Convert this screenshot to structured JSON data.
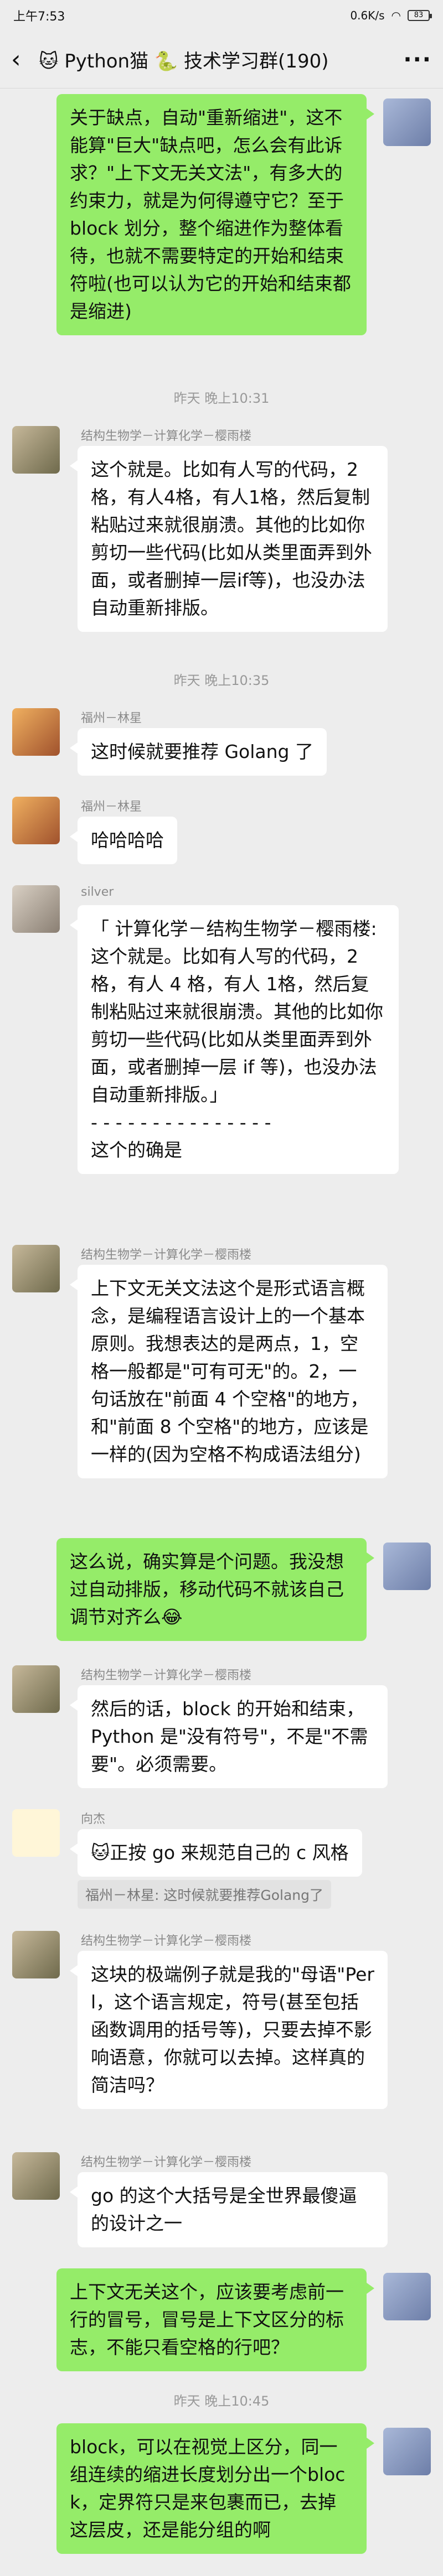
{
  "status_bar": {
    "time": "上午7:53",
    "network": "0.6K/s",
    "battery": "83"
  },
  "nav": {
    "back_icon": "‹",
    "title": "🐱 Python猫 🐍 技术学习群(190)",
    "more_icon": "···"
  },
  "messages": [
    {
      "id": "m1",
      "side": "right",
      "text": "关于缺点，自动\"重新缩进\"，这不能算\"巨大\"缺点吧，怎么会有此诉求？\"上下文无关文法\"，有多大的约束力，就是为何得遵守它？至于block 划分，整个缩进作为整体看待，也就不需要特定的开始和结束符啦(也可以认为它的开始和结束都是缩进)"
    },
    {
      "id": "t1",
      "type": "time",
      "text": "昨天 晚上10:31"
    },
    {
      "id": "m2",
      "side": "left",
      "sender": "结构生物学－计算化学－樱雨楼",
      "text": "这个就是。比如有人写的代码，2格，有人4格，有人1格，然后复制粘贴过来就很崩溃。其他的比如你剪切一些代码(比如从类里面弄到外面，或者删掉一层if等)，也没办法自动重新排版。"
    },
    {
      "id": "t2",
      "type": "time",
      "text": "昨天 晚上10:35"
    },
    {
      "id": "m3",
      "side": "left",
      "sender": "福州－林星",
      "text": "这时候就要推荐 Golang 了"
    },
    {
      "id": "m4",
      "side": "left",
      "sender": "福州－林星",
      "text": "哈哈哈哈"
    },
    {
      "id": "m5",
      "side": "left",
      "sender": "silver",
      "text": "「 计算化学－结构生物学－樱雨楼: 这个就是。比如有人写的代码，2格，有人 4 格，有人 1格，然后复制粘贴过来就很崩溃。其他的比如你剪切一些代码(比如从类里面弄到外面，或者删掉一层 if 等)，也没办法自动重新排版。」\n- - - - - - - - - - - - - - -\n这个的确是"
    },
    {
      "id": "m6",
      "side": "left",
      "sender": "结构生物学－计算化学－樱雨楼",
      "text": "上下文无关文法这个是形式语言概念，是编程语言设计上的一个基本原则。我想表达的是两点，1，空格一般都是\"可有可无\"的。2，一句话放在\"前面 4 个空格\"的地方，和\"前面 8 个空格\"的地方，应该是一样的(因为空格不构成语法组分)"
    },
    {
      "id": "m7",
      "side": "right",
      "text": "这么说，确实算是个问题。我没想过自动排版，移动代码不就该自己调节对齐么😂"
    },
    {
      "id": "m8",
      "side": "left",
      "sender": "结构生物学－计算化学－樱雨楼",
      "text": "然后的话，block 的开始和结束，Python 是\"没有符号\"，不是\"不需要\"。必须需要。"
    },
    {
      "id": "m9",
      "side": "left",
      "sender": "向杰",
      "text": "🐱正按 go 来规范自己的 c 风格",
      "quote": "福州－林星: 这时候就要推荐Golang了"
    },
    {
      "id": "m10",
      "side": "left",
      "sender": "结构生物学－计算化学－樱雨楼",
      "text": "这块的极端例子就是我的\"母语\"Perl，这个语言规定，符号(甚至包括函数调用的括号等)，只要去掉不影响语意，你就可以去掉。这样真的简洁吗？"
    },
    {
      "id": "m11",
      "side": "left",
      "sender": "结构生物学－计算化学－樱雨楼",
      "text": "go 的这个大括号是全世界最傻逼的设计之一"
    },
    {
      "id": "m12",
      "side": "right",
      "text": "上下文无关这个，应该要考虑前一行的冒号，冒号是上下文区分的标志，不能只看空格的行吧？"
    },
    {
      "id": "t3",
      "type": "time",
      "text": "昨天 晚上10:45"
    },
    {
      "id": "m13",
      "side": "right",
      "text": "block，可以在视觉上区分，同一组连续的缩进长度划分出一个block，定界符只是来包裹而已，去掉这层皮，还是能分组的啊"
    }
  ],
  "colors": {
    "background": "#ededed",
    "self_bubble": "#95ec69",
    "other_bubble": "#ffffff"
  }
}
